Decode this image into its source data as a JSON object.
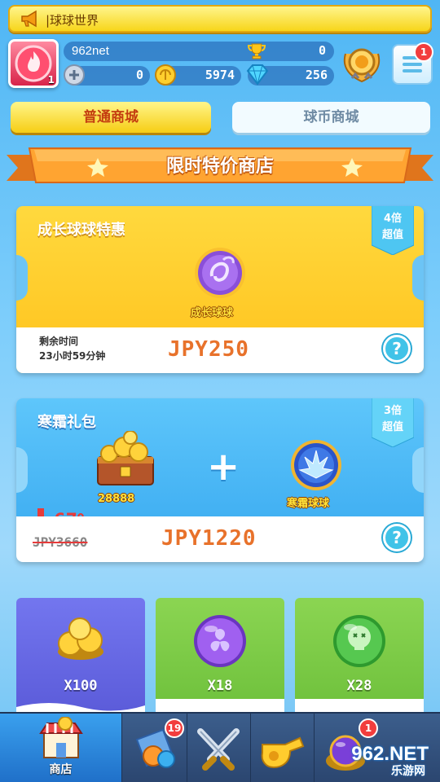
{
  "announcement": {
    "text": "|球球世界"
  },
  "player": {
    "name": "962net",
    "avatar_level": "1",
    "trophies": "0",
    "stats": [
      {
        "icon": "plus-coin-icon",
        "value": "0"
      },
      {
        "icon": "gold-coin-icon",
        "value": "5974"
      },
      {
        "icon": "diamond-icon",
        "value": "256"
      }
    ]
  },
  "menu": {
    "badge": "1"
  },
  "tabs": [
    {
      "label": "普通商城",
      "active": true
    },
    {
      "label": "球币商城",
      "active": false
    }
  ],
  "shop_title": "限时特价商店",
  "offers": [
    {
      "name": "成长球球特惠",
      "multiplier_line1": "4倍",
      "multiplier_line2": "超值",
      "item_label": "成长球球",
      "remain_label": "剩余时间",
      "remain_value": "23小时59分钟",
      "price": "JPY250",
      "help": "?"
    },
    {
      "name": "寒霜礼包",
      "multiplier_line1": "3倍",
      "multiplier_line2": "超值",
      "coins_label": "28888",
      "plus": "+",
      "item_label": "寒霜球球",
      "discount": "67%",
      "old_price": "JPY3660",
      "price": "JPY1220",
      "help": "?"
    }
  ],
  "grid_items": [
    {
      "qty": "X100",
      "icon": "gold-coins-icon",
      "color": "#6b6ee6"
    },
    {
      "qty": "X18",
      "icon": "purple-ball-icon",
      "color": "#7cc94b"
    },
    {
      "qty": "X28",
      "icon": "green-ball-icon",
      "color": "#7cc94b"
    }
  ],
  "bottom_nav": [
    {
      "label": "商店",
      "icon": "shop-icon",
      "active": true
    },
    {
      "label": "",
      "icon": "ball-launcher-icon",
      "badge": "19"
    },
    {
      "label": "",
      "icon": "crossed-swords-icon"
    },
    {
      "label": "",
      "icon": "whistle-icon"
    },
    {
      "label": "",
      "icon": "ball-bag-icon",
      "badge": "1"
    }
  ],
  "watermark": {
    "line1": "962.NET",
    "line2": "乐游网"
  },
  "colors": {
    "accent_yellow": "#ffc21c",
    "accent_blue": "#37a8ef",
    "price_orange": "#e8722b",
    "badge_red": "#f23d3d"
  }
}
